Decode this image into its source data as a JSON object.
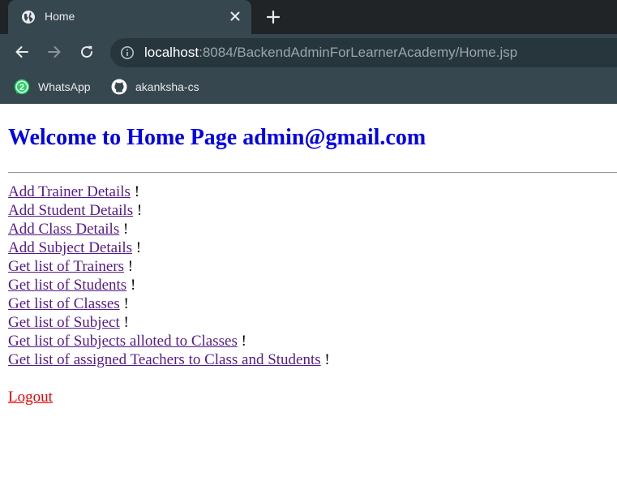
{
  "browser": {
    "tab": {
      "title": "Home",
      "icon": "globe-icon"
    },
    "address_bar": {
      "host": "localhost",
      "rest": ":8084/BackendAdminForLearnerAcademy/Home.jsp"
    },
    "bookmarks": [
      {
        "label": "WhatsApp",
        "icon": "whatsapp-icon",
        "badge": "2"
      },
      {
        "label": "akanksha-cs",
        "icon": "github-icon"
      }
    ]
  },
  "page": {
    "title": "Welcome to Home Page admin@gmail.com",
    "links": [
      {
        "text": "Add Trainer Details",
        "suffix": " !"
      },
      {
        "text": "Add Student Details",
        "suffix": " !"
      },
      {
        "text": "Add Class Details",
        "suffix": " !"
      },
      {
        "text": "Add Subject Details",
        "suffix": " !"
      },
      {
        "text": "Get list of Trainers",
        "suffix": " !"
      },
      {
        "text": "Get list of Students",
        "suffix": " !"
      },
      {
        "text": "Get list of Classes",
        "suffix": " !"
      },
      {
        "text": "Get list of Subject",
        "suffix": " !"
      },
      {
        "text": "Get list of Subjects alloted to Classes",
        "suffix": " !"
      },
      {
        "text": "Get list of assigned Teachers to Class and Students",
        "suffix": " !"
      }
    ],
    "logout": "Logout"
  },
  "colors": {
    "title": "#0000ee",
    "visited_link": "#551a8b",
    "logout_link": "#ee0000",
    "chrome_bg": "#36474f",
    "tabstrip_bg": "#202427"
  }
}
